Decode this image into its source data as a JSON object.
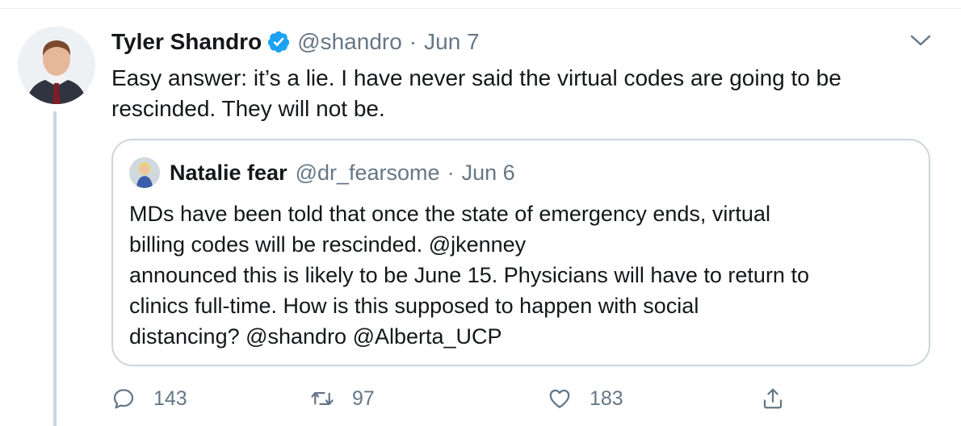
{
  "tweet": {
    "author_name": "Tyler Shandro",
    "handle": "@shandro",
    "separator": "·",
    "date": "Jun 7",
    "text_lines": [
      "Easy answer: it’s a lie. I have never said the virtual codes are going to be",
      "rescinded. They will not be."
    ],
    "verified": true,
    "accent_color": "#1da1f2"
  },
  "quoted": {
    "author_name": "Natalie fear",
    "handle": "@dr_fearsome",
    "separator": "·",
    "date": "Jun 6",
    "text_lines": [
      "MDs have been told that once the state of emergency ends, virtual",
      "billing codes will be rescinded. @jkenney",
      "announced this is likely to be June 15. Physicians will have to return to",
      "clinics full-time. How is this supposed to happen with social",
      "distancing? @shandro @Alberta_UCP"
    ]
  },
  "actions": {
    "reply_count": "143",
    "retweet_count": "97",
    "like_count": "183",
    "icons": [
      "reply-icon",
      "retweet-icon",
      "like-icon",
      "share-icon"
    ]
  }
}
